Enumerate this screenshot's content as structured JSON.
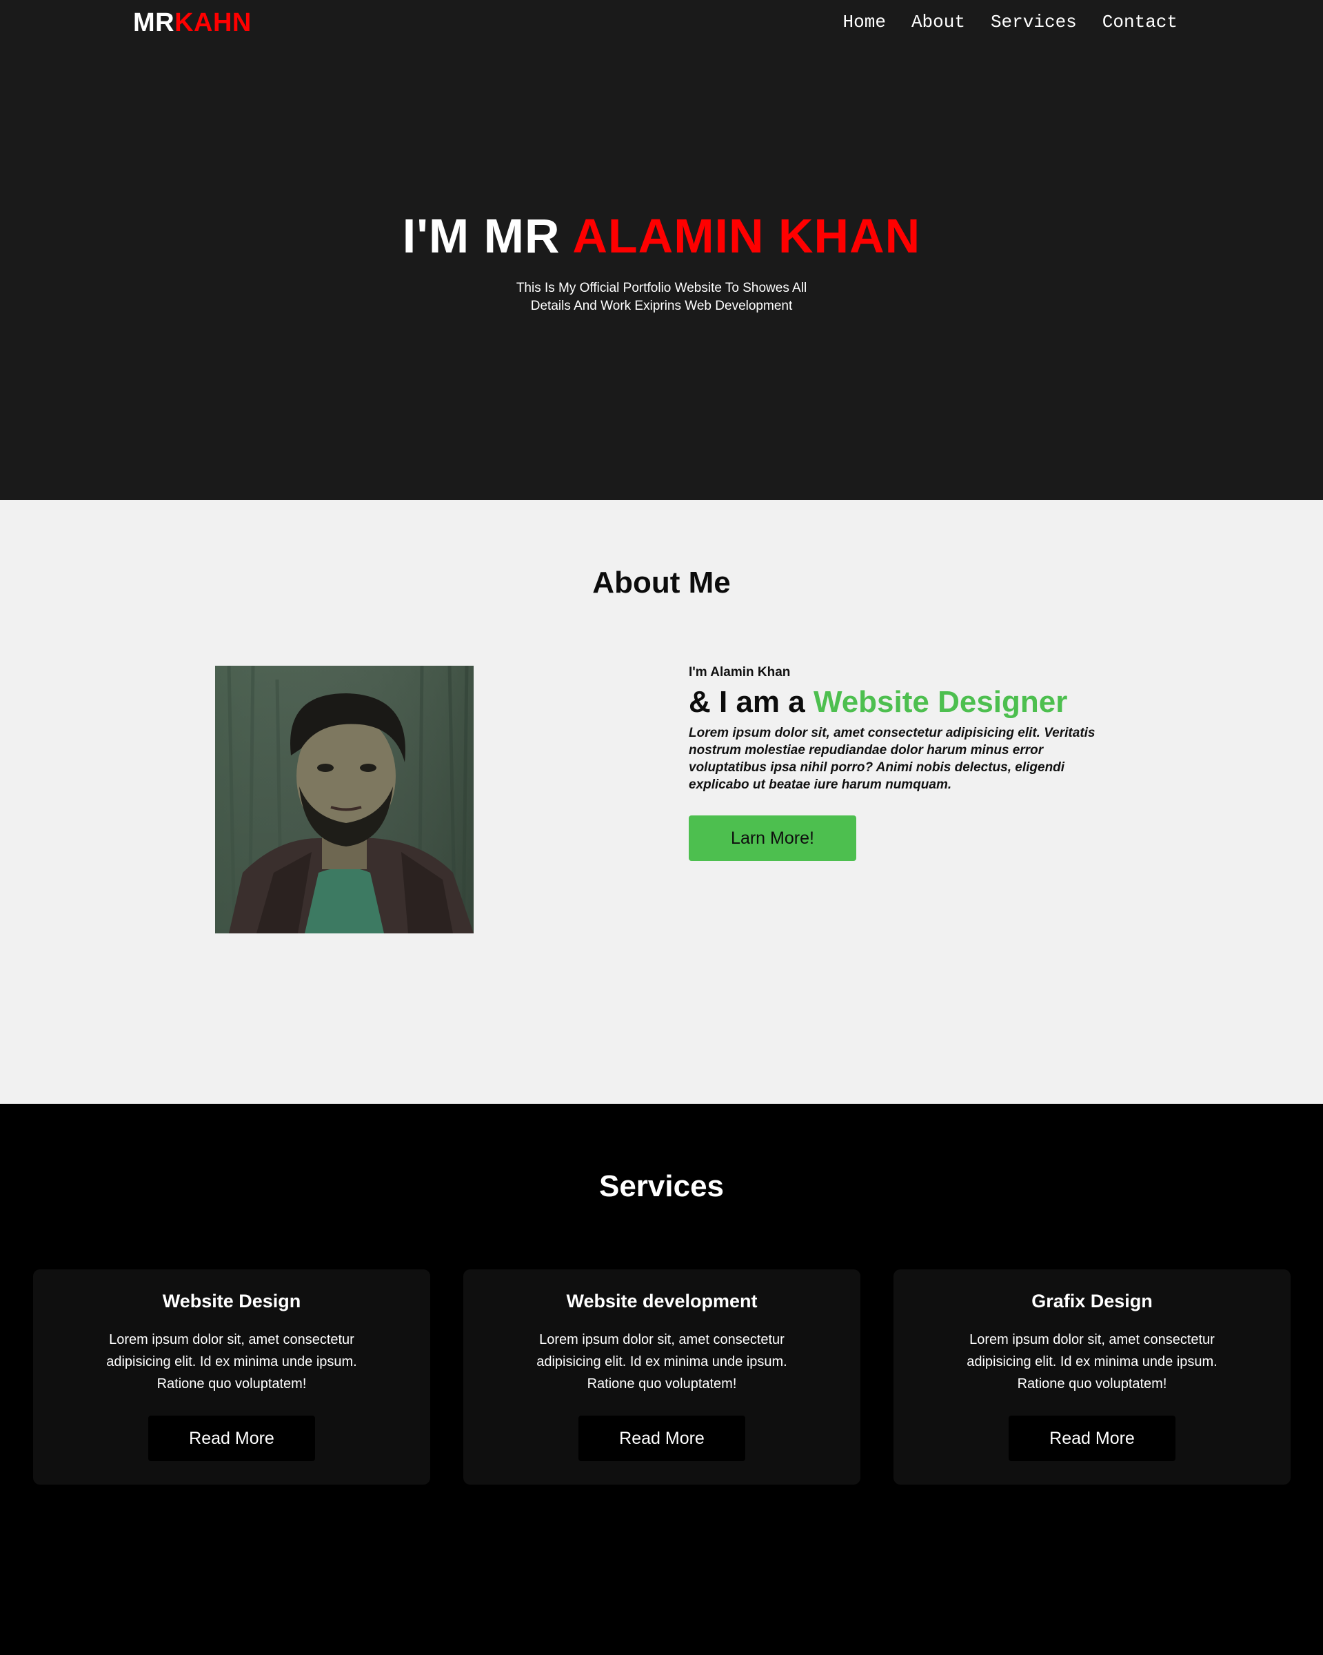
{
  "nav": {
    "logo_part1": "MR",
    "logo_part2": "KAHN",
    "links": [
      "Home",
      "About",
      "Services",
      "Contact"
    ]
  },
  "hero": {
    "title_part1": "I'M MR ",
    "title_part2": "ALAMIN KHAN",
    "subtitle_line1": "This Is My Official Portfolio Website To Showes All",
    "subtitle_line2": "Details And Work Exiprins Web Development"
  },
  "about": {
    "heading": "About Me",
    "intro": "I'm Alamin Khan",
    "role_prefix": "& I am a ",
    "role_highlight": "Website Designer",
    "paragraph": "Lorem ipsum dolor sit, amet consectetur adipisicing elit. Veritatis nostrum molestiae repudiandae dolor harum minus error voluptatibus ipsa nihil porro? Animi nobis delectus, eligendi explicabo ut beatae iure harum numquam.",
    "button_label": "Larn More!"
  },
  "services": {
    "heading": "Services",
    "cards": [
      {
        "title": "Website Design",
        "text": "Lorem ipsum dolor sit, amet consectetur adipisicing elit. Id ex minima unde ipsum. Ratione quo voluptatem!",
        "button_label": "Read More"
      },
      {
        "title": "Website development",
        "text": "Lorem ipsum dolor sit, amet consectetur adipisicing elit. Id ex minima unde ipsum. Ratione quo voluptatem!",
        "button_label": "Read More"
      },
      {
        "title": "Grafix Design",
        "text": "Lorem ipsum dolor sit, amet consectetur adipisicing elit. Id ex minima unde ipsum. Ratione quo voluptatem!",
        "button_label": "Read More"
      }
    ]
  },
  "colors": {
    "hero_bg": "#1a1a1a",
    "about_bg": "#f1f1f1",
    "services_bg": "#000000",
    "card_bg": "#0f0f0f",
    "accent_red": "#ff0000",
    "accent_green": "#4dbf4f"
  }
}
